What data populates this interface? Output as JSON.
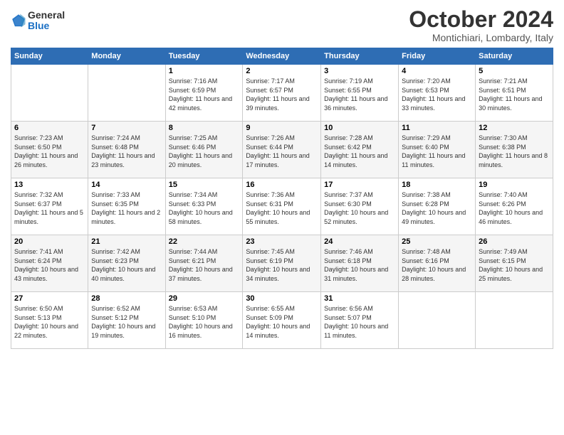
{
  "logo": {
    "general": "General",
    "blue": "Blue"
  },
  "title": "October 2024",
  "location": "Montichiari, Lombardy, Italy",
  "days_header": [
    "Sunday",
    "Monday",
    "Tuesday",
    "Wednesday",
    "Thursday",
    "Friday",
    "Saturday"
  ],
  "weeks": [
    [
      {
        "day": "",
        "info": ""
      },
      {
        "day": "",
        "info": ""
      },
      {
        "day": "1",
        "info": "Sunrise: 7:16 AM\nSunset: 6:59 PM\nDaylight: 11 hours\nand 42 minutes."
      },
      {
        "day": "2",
        "info": "Sunrise: 7:17 AM\nSunset: 6:57 PM\nDaylight: 11 hours\nand 39 minutes."
      },
      {
        "day": "3",
        "info": "Sunrise: 7:19 AM\nSunset: 6:55 PM\nDaylight: 11 hours\nand 36 minutes."
      },
      {
        "day": "4",
        "info": "Sunrise: 7:20 AM\nSunset: 6:53 PM\nDaylight: 11 hours\nand 33 minutes."
      },
      {
        "day": "5",
        "info": "Sunrise: 7:21 AM\nSunset: 6:51 PM\nDaylight: 11 hours\nand 30 minutes."
      }
    ],
    [
      {
        "day": "6",
        "info": "Sunrise: 7:23 AM\nSunset: 6:50 PM\nDaylight: 11 hours\nand 26 minutes."
      },
      {
        "day": "7",
        "info": "Sunrise: 7:24 AM\nSunset: 6:48 PM\nDaylight: 11 hours\nand 23 minutes."
      },
      {
        "day": "8",
        "info": "Sunrise: 7:25 AM\nSunset: 6:46 PM\nDaylight: 11 hours\nand 20 minutes."
      },
      {
        "day": "9",
        "info": "Sunrise: 7:26 AM\nSunset: 6:44 PM\nDaylight: 11 hours\nand 17 minutes."
      },
      {
        "day": "10",
        "info": "Sunrise: 7:28 AM\nSunset: 6:42 PM\nDaylight: 11 hours\nand 14 minutes."
      },
      {
        "day": "11",
        "info": "Sunrise: 7:29 AM\nSunset: 6:40 PM\nDaylight: 11 hours\nand 11 minutes."
      },
      {
        "day": "12",
        "info": "Sunrise: 7:30 AM\nSunset: 6:38 PM\nDaylight: 11 hours\nand 8 minutes."
      }
    ],
    [
      {
        "day": "13",
        "info": "Sunrise: 7:32 AM\nSunset: 6:37 PM\nDaylight: 11 hours\nand 5 minutes."
      },
      {
        "day": "14",
        "info": "Sunrise: 7:33 AM\nSunset: 6:35 PM\nDaylight: 11 hours\nand 2 minutes."
      },
      {
        "day": "15",
        "info": "Sunrise: 7:34 AM\nSunset: 6:33 PM\nDaylight: 10 hours\nand 58 minutes."
      },
      {
        "day": "16",
        "info": "Sunrise: 7:36 AM\nSunset: 6:31 PM\nDaylight: 10 hours\nand 55 minutes."
      },
      {
        "day": "17",
        "info": "Sunrise: 7:37 AM\nSunset: 6:30 PM\nDaylight: 10 hours\nand 52 minutes."
      },
      {
        "day": "18",
        "info": "Sunrise: 7:38 AM\nSunset: 6:28 PM\nDaylight: 10 hours\nand 49 minutes."
      },
      {
        "day": "19",
        "info": "Sunrise: 7:40 AM\nSunset: 6:26 PM\nDaylight: 10 hours\nand 46 minutes."
      }
    ],
    [
      {
        "day": "20",
        "info": "Sunrise: 7:41 AM\nSunset: 6:24 PM\nDaylight: 10 hours\nand 43 minutes."
      },
      {
        "day": "21",
        "info": "Sunrise: 7:42 AM\nSunset: 6:23 PM\nDaylight: 10 hours\nand 40 minutes."
      },
      {
        "day": "22",
        "info": "Sunrise: 7:44 AM\nSunset: 6:21 PM\nDaylight: 10 hours\nand 37 minutes."
      },
      {
        "day": "23",
        "info": "Sunrise: 7:45 AM\nSunset: 6:19 PM\nDaylight: 10 hours\nand 34 minutes."
      },
      {
        "day": "24",
        "info": "Sunrise: 7:46 AM\nSunset: 6:18 PM\nDaylight: 10 hours\nand 31 minutes."
      },
      {
        "day": "25",
        "info": "Sunrise: 7:48 AM\nSunset: 6:16 PM\nDaylight: 10 hours\nand 28 minutes."
      },
      {
        "day": "26",
        "info": "Sunrise: 7:49 AM\nSunset: 6:15 PM\nDaylight: 10 hours\nand 25 minutes."
      }
    ],
    [
      {
        "day": "27",
        "info": "Sunrise: 6:50 AM\nSunset: 5:13 PM\nDaylight: 10 hours\nand 22 minutes."
      },
      {
        "day": "28",
        "info": "Sunrise: 6:52 AM\nSunset: 5:12 PM\nDaylight: 10 hours\nand 19 minutes."
      },
      {
        "day": "29",
        "info": "Sunrise: 6:53 AM\nSunset: 5:10 PM\nDaylight: 10 hours\nand 16 minutes."
      },
      {
        "day": "30",
        "info": "Sunrise: 6:55 AM\nSunset: 5:09 PM\nDaylight: 10 hours\nand 14 minutes."
      },
      {
        "day": "31",
        "info": "Sunrise: 6:56 AM\nSunset: 5:07 PM\nDaylight: 10 hours\nand 11 minutes."
      },
      {
        "day": "",
        "info": ""
      },
      {
        "day": "",
        "info": ""
      }
    ]
  ]
}
